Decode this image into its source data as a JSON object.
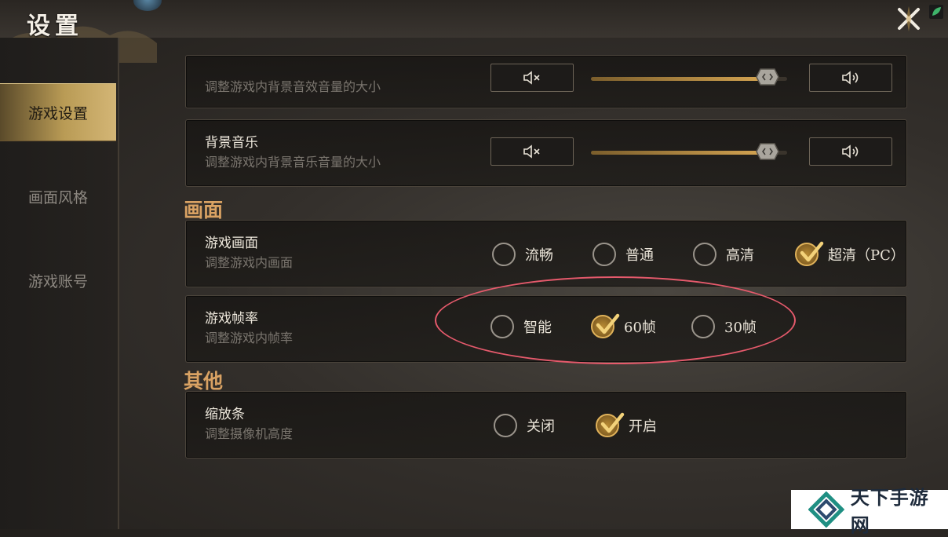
{
  "header": {
    "title": "设置"
  },
  "sidebar": {
    "items": [
      {
        "label": "游戏设置",
        "active": true
      },
      {
        "label": "画面风格",
        "active": false
      },
      {
        "label": "游戏账号",
        "active": false
      }
    ]
  },
  "audio": {
    "effects": {
      "subtitle": "调整游戏内背景音效音量的大小",
      "level": 0.9
    },
    "music": {
      "title": "背景音乐",
      "subtitle": "调整游戏内背景音乐音量的大小",
      "level": 0.9
    }
  },
  "sections": {
    "graphics": "画面",
    "other": "其他"
  },
  "quality": {
    "title": "游戏画面",
    "subtitle": "调整游戏内画面",
    "options": [
      "流畅",
      "普通",
      "高清",
      "超清（PC）"
    ],
    "selected": 3
  },
  "framerate": {
    "title": "游戏帧率",
    "subtitle": "调整游戏内帧率",
    "options": [
      "智能",
      "60帧",
      "30帧"
    ],
    "selected": 1
  },
  "zoom_bar": {
    "title": "缩放条",
    "subtitle": "调整摄像机高度",
    "options": [
      "关闭",
      "开启"
    ],
    "selected": 1
  },
  "colors": {
    "accent": "#d9a263",
    "check": "#e0b25a",
    "highlight": "#e65a6c"
  },
  "watermark": {
    "text": "天下手游网"
  },
  "icons": [
    "mute-icon",
    "volume-up-icon",
    "check-icon",
    "close-icon",
    "leaf-icon"
  ]
}
